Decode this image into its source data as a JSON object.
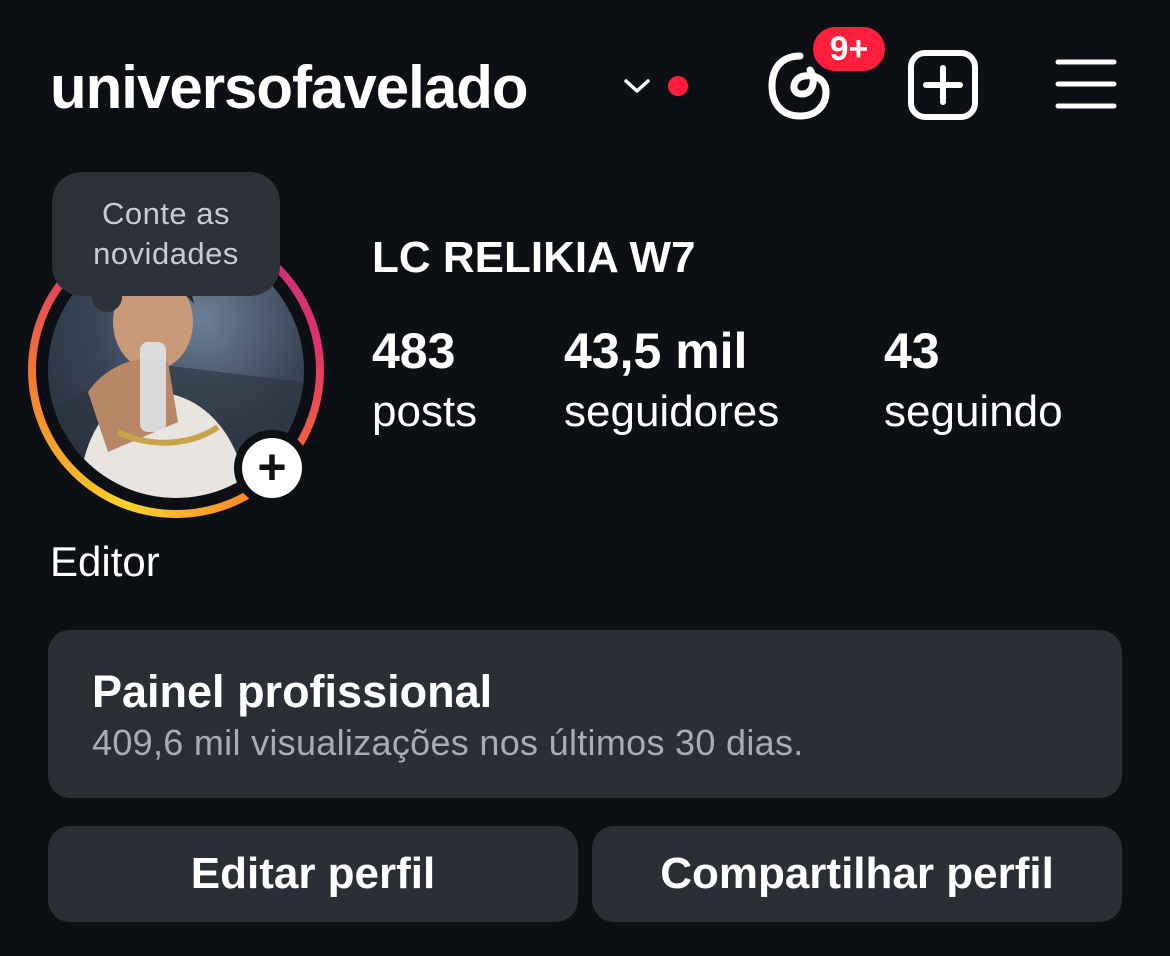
{
  "header": {
    "username": "universofavelado",
    "notification_badge": "9+",
    "icons": [
      "chevron-down-icon",
      "threads-icon",
      "create-post-icon",
      "menu-icon"
    ],
    "accent_color": "#ff1e3c"
  },
  "profile": {
    "note": "Conte as novidades",
    "display_name": "LC RELIKIA W7",
    "category": "Editor",
    "stats": {
      "posts_value": "483",
      "posts_label": "posts",
      "followers_value": "43,5 mil",
      "followers_label": "seguidores",
      "following_value": "43",
      "following_label": "seguindo"
    }
  },
  "professional_panel": {
    "title": "Painel profissional",
    "subtitle": "409,6 mil visualizações nos últimos 30 dias."
  },
  "actions": {
    "edit_label": "Editar perfil",
    "share_label": "Compartilhar perfil"
  }
}
